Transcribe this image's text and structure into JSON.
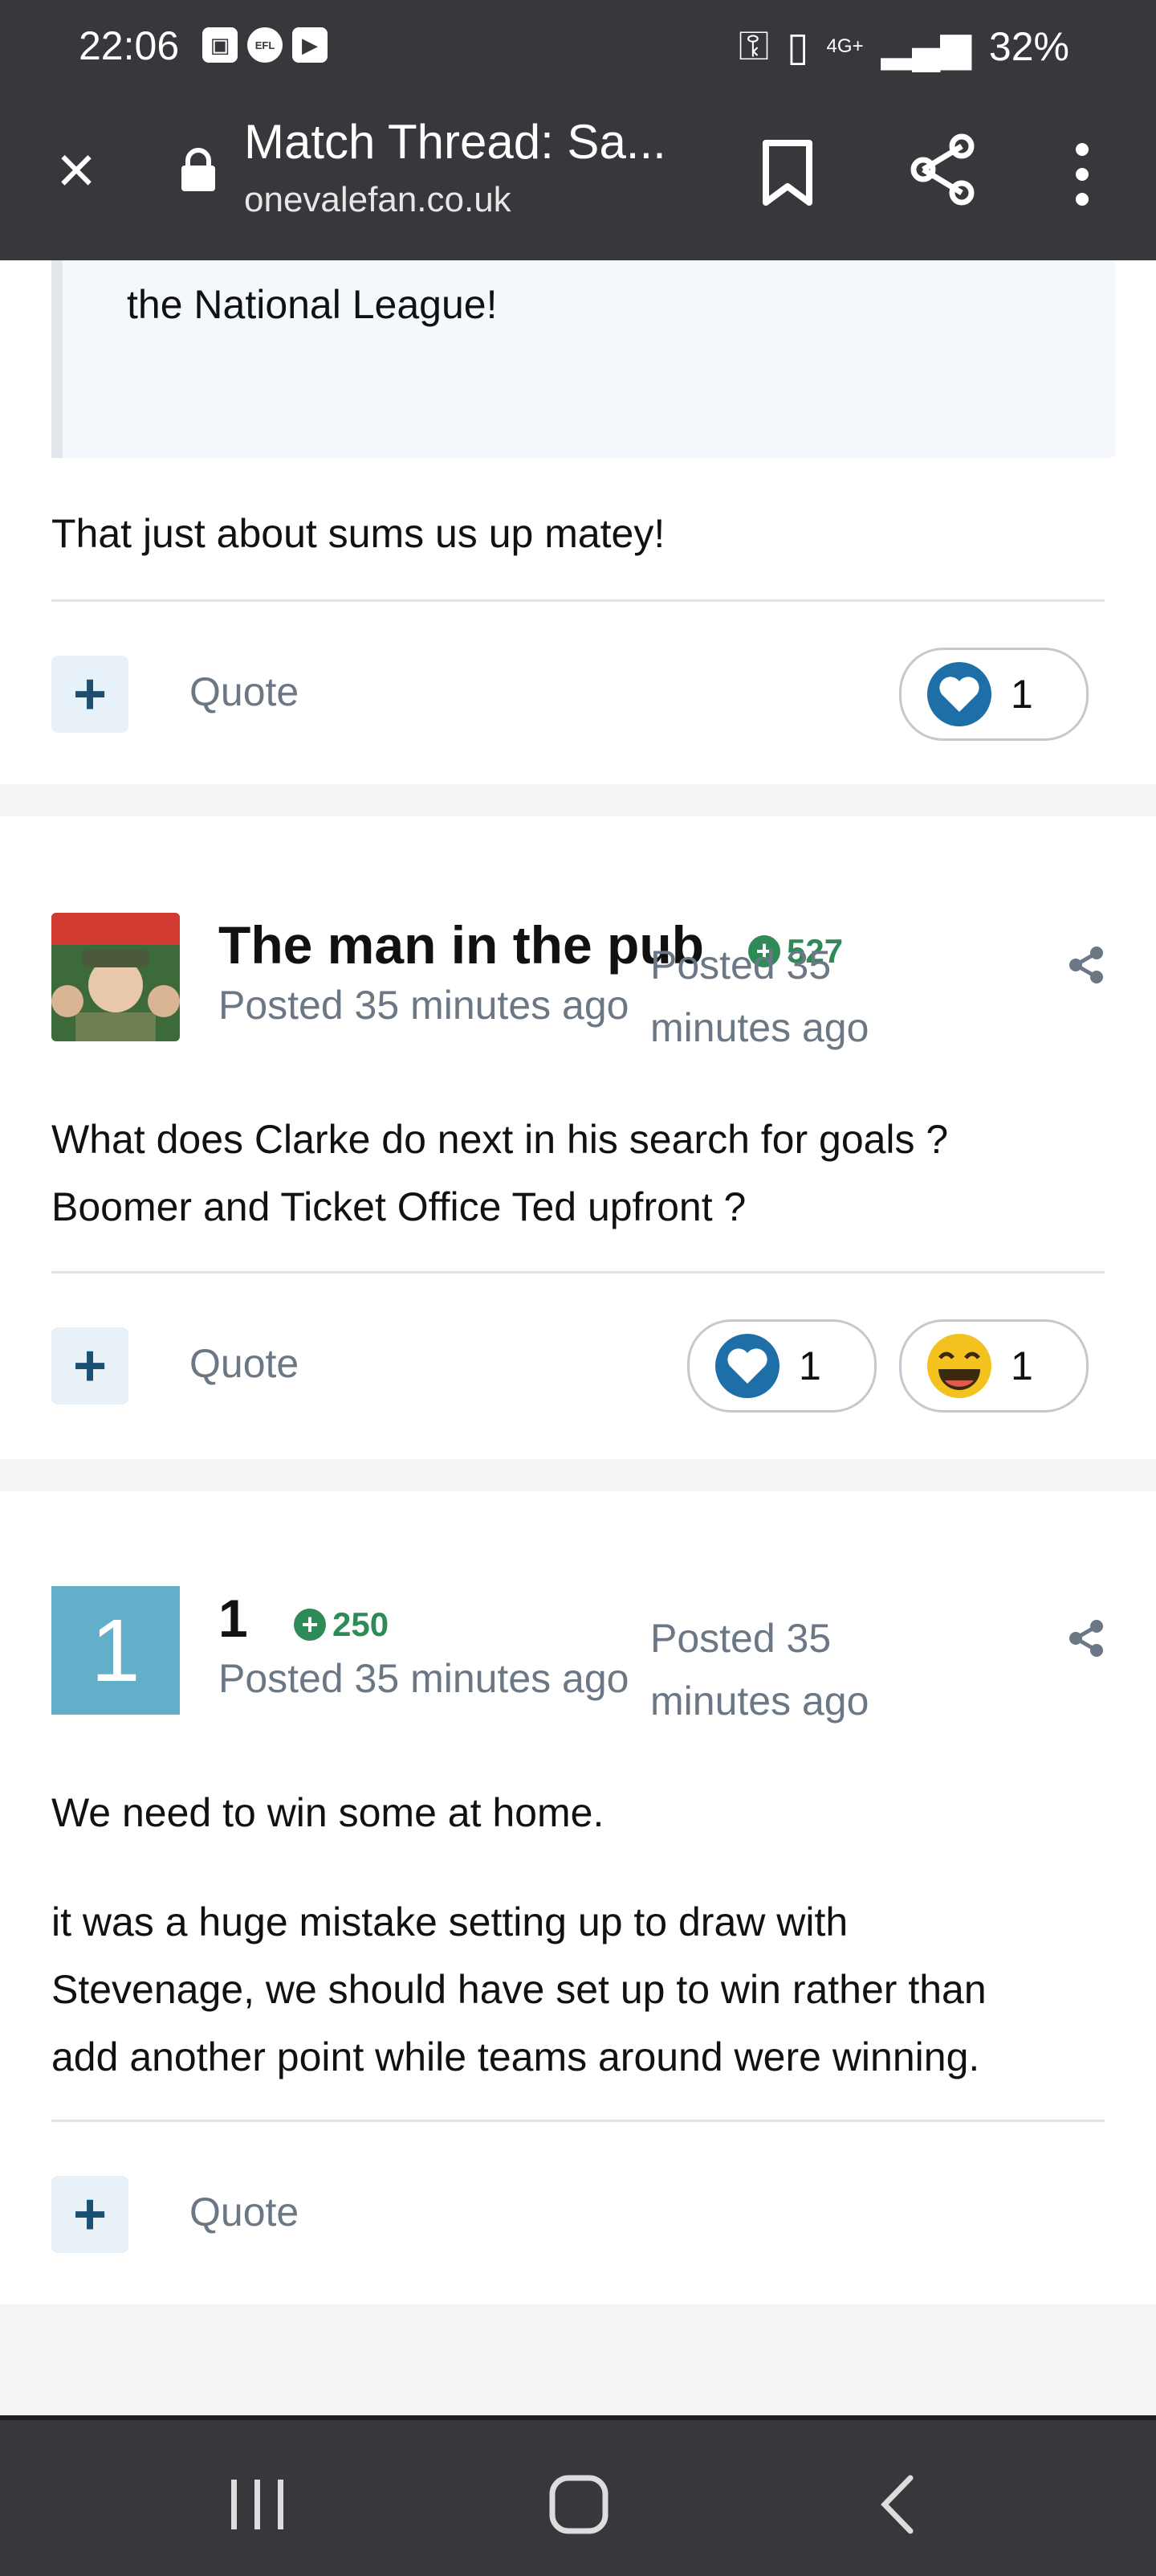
{
  "status_bar": {
    "time": "22:06",
    "network": "4G+",
    "battery": "32%"
  },
  "browser": {
    "title": "Match Thread: Sa...",
    "url": "onevalefan.co.uk"
  },
  "post_top": {
    "quote_text": "the National League!",
    "body": "That just about sums us up matey!",
    "quote_label": "Quote",
    "reaction_count": "1"
  },
  "post_pub": {
    "author": "The man in the pub",
    "reputation": "527",
    "posted": "Posted 35 minutes ago",
    "posted_wrapped_1": "Posted 35",
    "posted_wrapped_2": "minutes ago",
    "body_line1": "What does Clarke do next in his search for goals ?",
    "body_line2": "Boomer and Ticket Office Ted upfront ?",
    "quote_label": "Quote",
    "reaction_like_count": "1",
    "reaction_haha_count": "1"
  },
  "post_one": {
    "avatar_letter": "1",
    "author": "1",
    "reputation": "250",
    "posted": "Posted 35 minutes ago",
    "posted_wrapped_1": "Posted 35",
    "posted_wrapped_2": "minutes ago",
    "paragraph1": "We need to win some at home.",
    "paragraph2_line1": "it was a huge mistake setting up to draw with",
    "paragraph2_line2": "Stevenage, we should have set up to win rather than",
    "paragraph2_line3": "add another point while teams around were winning.",
    "quote_label": "Quote"
  },
  "colors": {
    "reaction_blue": "#1e6fa8",
    "rep_green": "#2e8b57",
    "avatar_blue": "#63aec8"
  }
}
